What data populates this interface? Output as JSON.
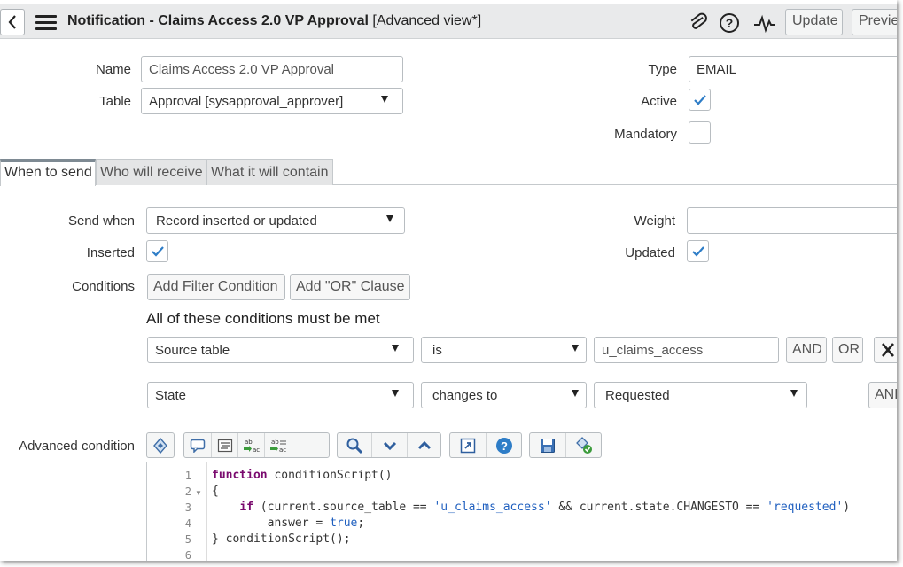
{
  "header": {
    "title_bold": "Notification - Claims Access 2.0 VP Approval",
    "title_suffix": "[Advanced view*]",
    "update_label": "Update",
    "preview_label": "Previe"
  },
  "form": {
    "name_label": "Name",
    "name_value": "Claims Access 2.0 VP Approval",
    "table_label": "Table",
    "table_value": "Approval [sysapproval_approver]",
    "type_label": "Type",
    "type_value": "EMAIL",
    "active_label": "Active",
    "active_checked": true,
    "mandatory_label": "Mandatory",
    "mandatory_checked": false
  },
  "tabs": [
    {
      "label": "When to send",
      "active": true
    },
    {
      "label": "Who will receive",
      "active": false
    },
    {
      "label": "What it will contain",
      "active": false
    }
  ],
  "when": {
    "send_when_label": "Send when",
    "send_when_value": "Record inserted or updated",
    "weight_label": "Weight",
    "weight_value": "",
    "inserted_label": "Inserted",
    "inserted_checked": true,
    "updated_label": "Updated",
    "updated_checked": true,
    "conditions_label": "Conditions",
    "add_filter_label": "Add Filter Condition",
    "add_or_label": "Add \"OR\" Clause",
    "conditions_heading": "All of these conditions must be met",
    "conditions": [
      {
        "field": "Source table",
        "operator": "is",
        "value": "u_claims_access"
      },
      {
        "field": "State",
        "operator": "changes to",
        "value": "Requested"
      }
    ],
    "and_label": "AND",
    "or_label": "OR",
    "and_label_2": "AND",
    "advanced_label": "Advanced condition"
  },
  "toolbar_icons": [
    "toggle-syntax-icon",
    "comment-icon",
    "format-icon",
    "replace-icon",
    "replace-all-icon",
    "search-icon",
    "fold-down-icon",
    "fold-up-icon",
    "fullscreen-icon",
    "help-icon",
    "save-icon",
    "validate-icon"
  ],
  "editor": {
    "line_numbers": [
      "1",
      "2",
      "3",
      "4",
      "5",
      "6"
    ],
    "lines": [
      {
        "kw": "function",
        "rest": " conditionScript()"
      },
      {
        "text": "{"
      },
      {
        "indent": "    ",
        "kw": "if",
        "p1": " (current.source_table == ",
        "s1": "'u_claims_access'",
        "p2": " && current.state.CHANGESTO == ",
        "s2": "'requested'",
        "p3": ")"
      },
      {
        "text": "        answer = ",
        "s": "true",
        "end": ";"
      },
      {
        "text": "} conditionScript();"
      },
      {
        "text": ""
      }
    ]
  },
  "colors": {
    "checkmark": "#2e7dc7",
    "keyword": "#7a0a6e",
    "string": "#1f5fbf"
  }
}
